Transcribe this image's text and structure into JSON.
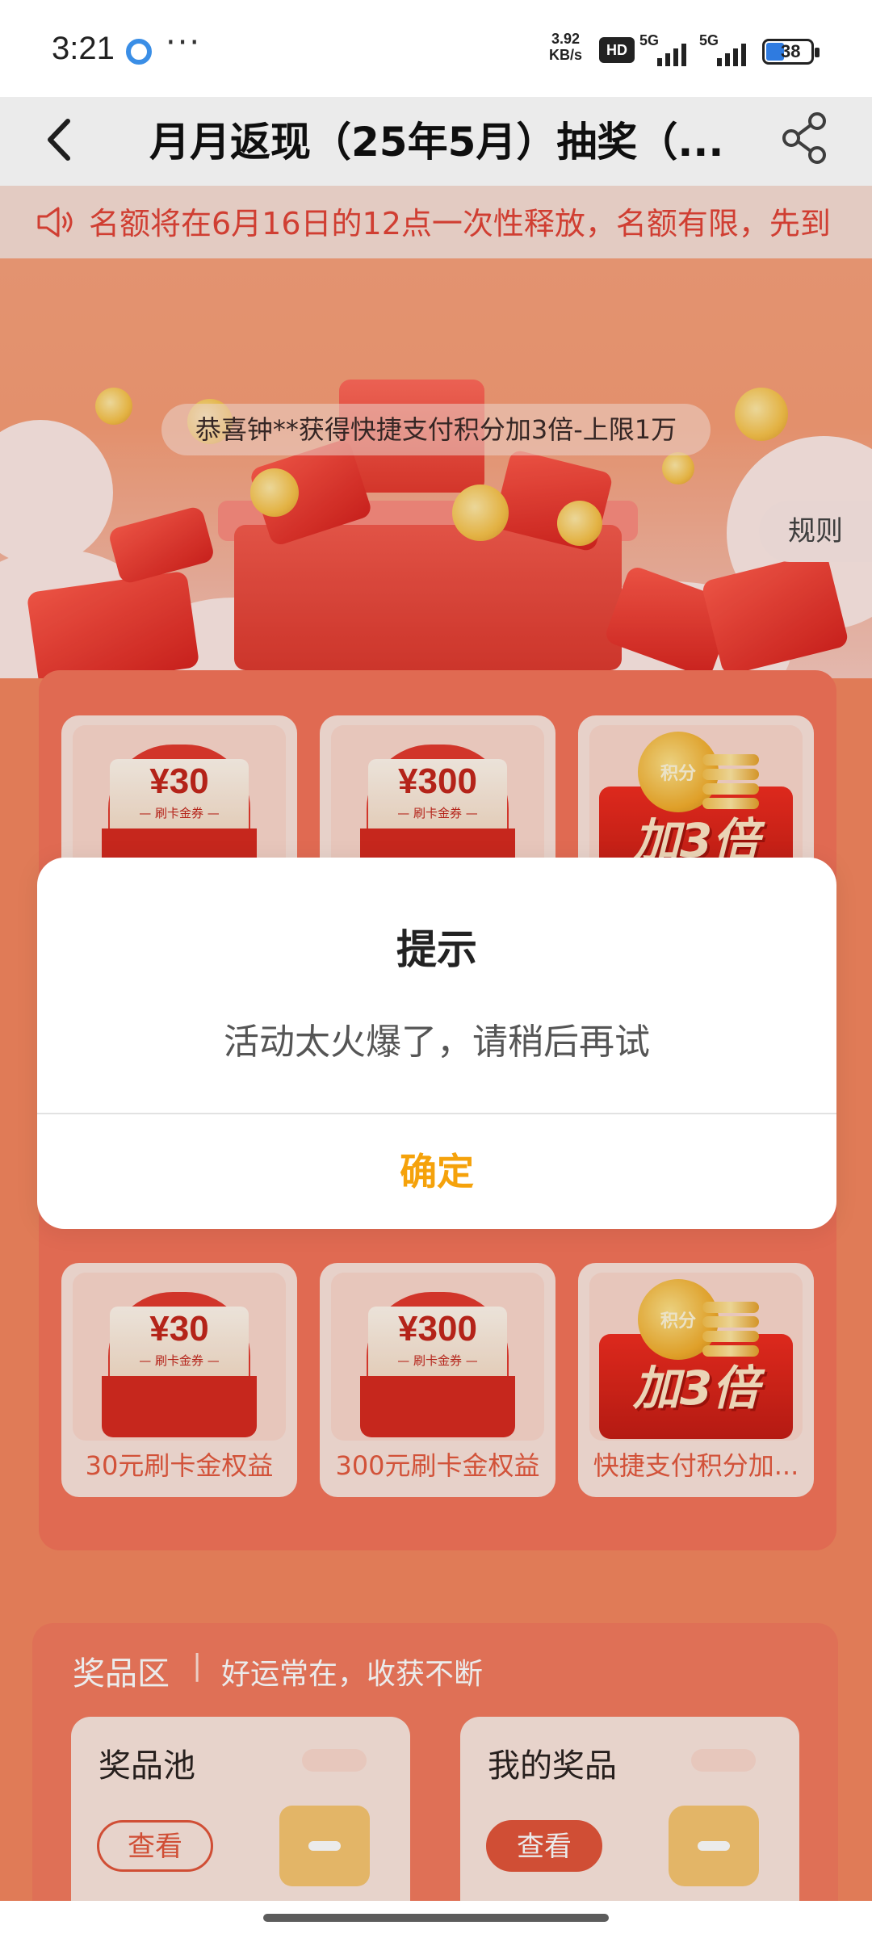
{
  "status_bar": {
    "time": "3:21",
    "dots": "···",
    "speed_value": "3.92",
    "speed_unit": "KB/s",
    "hd_label": "HD",
    "signal1_label": "5G",
    "signal2_label": "5G",
    "battery_level": "38"
  },
  "nav": {
    "title": "月月返现（25年5月）抽奖（..."
  },
  "marquee": {
    "text": "名额将在6月16日的12点一次性释放，名额有限，先到"
  },
  "hero": {
    "winner_text": "恭喜钟**获得快捷支付积分加3倍-上限1万",
    "rules_label": "规则"
  },
  "prizes": [
    {
      "amount": "¥30",
      "ticket_sub": "— 刷卡金券 —",
      "label": "30元刷卡金权益"
    },
    {
      "amount": "¥300",
      "ticket_sub": "— 刷卡金券 —",
      "label": "300元刷卡金权益"
    },
    {
      "coin_label": "积分",
      "bonus_text": "加3倍",
      "label": "快捷支付积分加..."
    }
  ],
  "prize_area": {
    "title": "奖品区",
    "separator": "|",
    "subtitle": "好运常在，收获不断",
    "pool": {
      "title": "奖品池",
      "button": "查看"
    },
    "mine": {
      "title": "我的奖品",
      "button": "查看"
    }
  },
  "dialog": {
    "title": "提示",
    "message": "活动太火爆了，请稍后再试",
    "confirm": "确定"
  },
  "colors": {
    "accent": "#f5a20b",
    "brand_red": "#e24437",
    "page_bg": "#f4865f"
  }
}
